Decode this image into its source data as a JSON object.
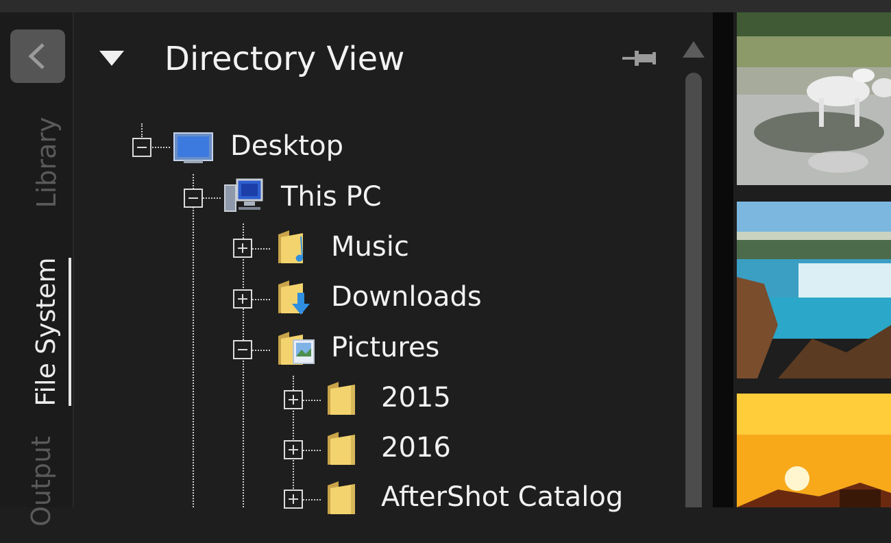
{
  "side_tabs": {
    "library": "Library",
    "file_system": "File System",
    "output": "Output"
  },
  "panel": {
    "title": "Directory View"
  },
  "tree": {
    "desktop": "Desktop",
    "this_pc": "This PC",
    "music": "Music",
    "downloads": "Downloads",
    "pictures": "Pictures",
    "y2015": "2015",
    "y2016": "2016",
    "aftershot": "AfterShot Catalog"
  },
  "icons": {
    "back": "chevron-left-icon",
    "collapse": "triangle-down-icon",
    "pin": "pin-icon",
    "desktop": "monitor-icon",
    "this_pc": "computer-icon",
    "music": "music-folder-icon",
    "downloads": "downloads-folder-icon",
    "pictures": "pictures-folder-icon",
    "folder": "folder-icon"
  },
  "colors": {
    "background": "#1e1e1e",
    "text": "#f2f2f2",
    "inactive_tab": "#5a5a5a"
  },
  "thumbnails": [
    "white horse in water",
    "waterfall landscape",
    "sunset"
  ]
}
